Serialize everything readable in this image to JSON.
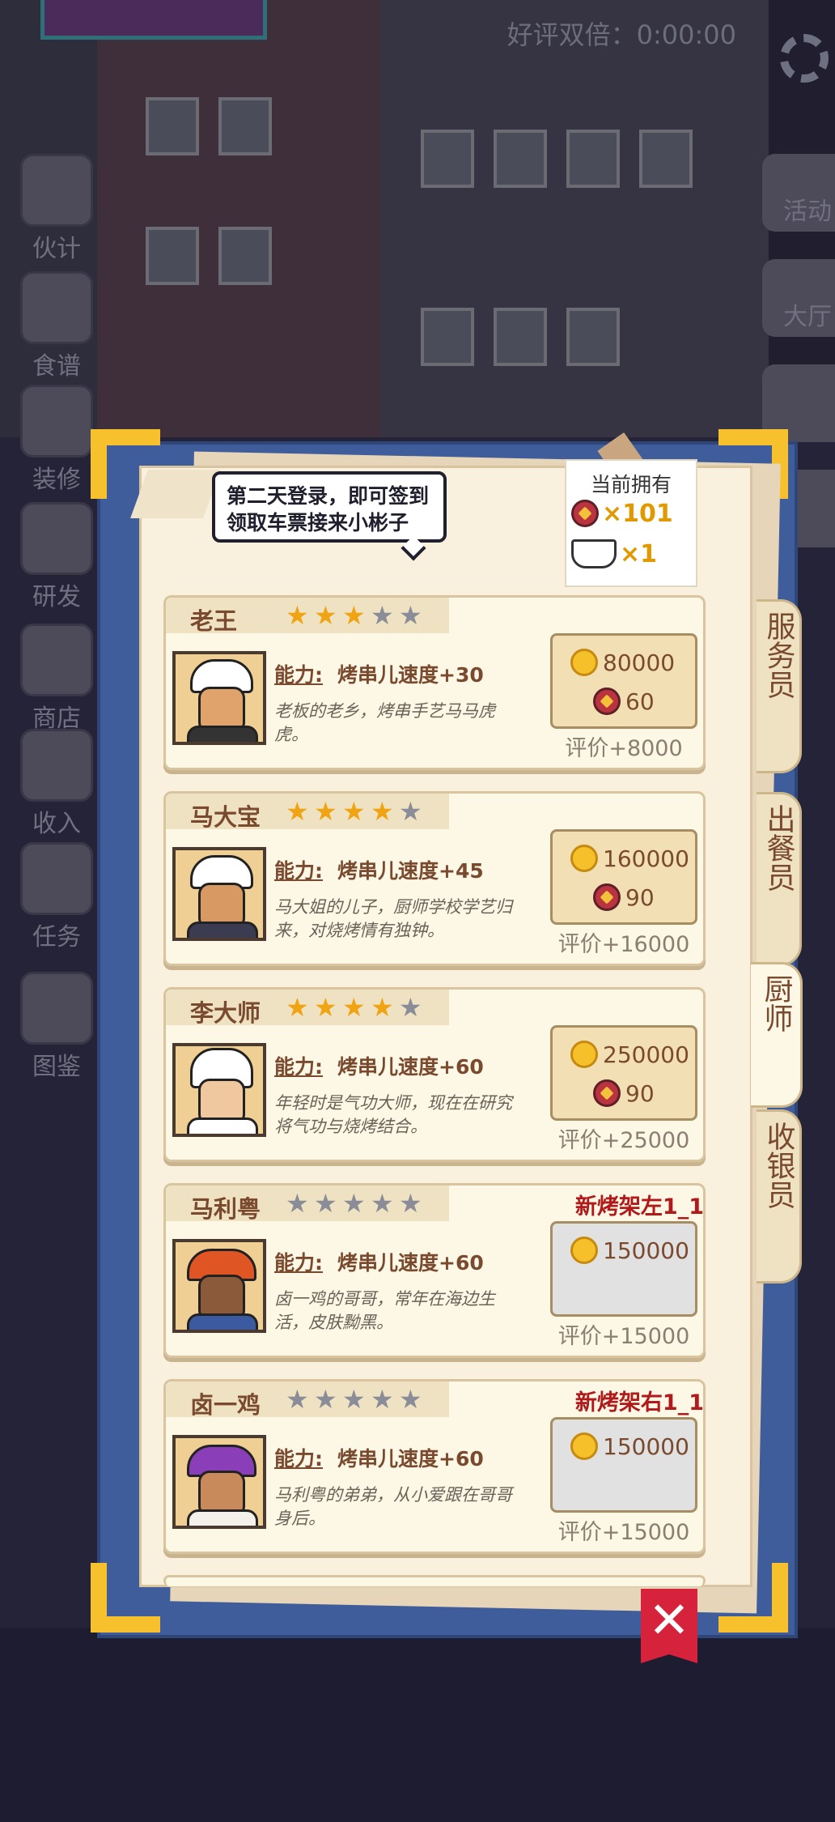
{
  "hud": {
    "top_sign": "",
    "good_review_label": "好评双倍：0:00:00",
    "left_menu": [
      {
        "label": "伙计",
        "icon": "chef-icon"
      },
      {
        "label": "食谱",
        "icon": "skewer-icon"
      },
      {
        "label": "装修",
        "icon": "graduation-cap-icon"
      },
      {
        "label": "研发",
        "icon": "research-icon"
      },
      {
        "label": "商店",
        "icon": "shop-icon"
      },
      {
        "label": "收入",
        "icon": "income-chart-icon"
      },
      {
        "label": "任务",
        "icon": "task-board-icon"
      },
      {
        "label": "图鉴",
        "icon": "catalog-icon"
      }
    ],
    "right_menu": [
      {
        "label": "活动",
        "icon": "calendar-icon"
      },
      {
        "label": "大厅",
        "icon": "hall-icon"
      },
      {
        "label": "",
        "icon": "table-icon"
      },
      {
        "label": "",
        "icon": "ranking-icon"
      }
    ]
  },
  "hint": {
    "line1": "第二天登录，即可签到",
    "line2": "领取车票接来小彬子"
  },
  "owned": {
    "title": "当前拥有",
    "tokens": "×101",
    "tickets": "×1"
  },
  "tabs": [
    {
      "label": "服务员",
      "active": false
    },
    {
      "label": "出餐员",
      "active": false
    },
    {
      "label": "厨师",
      "active": true
    },
    {
      "label": "收银员",
      "active": false
    }
  ],
  "staff": [
    {
      "name": "老王",
      "stars": 3,
      "ability_label": "能力:",
      "ability": "烤串儿速度+30",
      "desc": "老板的老乡，烤串手艺马马虎虎。",
      "coin_cost": "80000",
      "token_cost": "60",
      "review": "评价+8000",
      "unlock": "",
      "locked": false
    },
    {
      "name": "马大宝",
      "stars": 4,
      "ability_label": "能力:",
      "ability": "烤串儿速度+45",
      "desc": "马大姐的儿子，厨师学校学艺归来，对烧烤情有独钟。",
      "coin_cost": "160000",
      "token_cost": "90",
      "review": "评价+16000",
      "unlock": "",
      "locked": false
    },
    {
      "name": "李大师",
      "stars": 4,
      "ability_label": "能力:",
      "ability": "烤串儿速度+60",
      "desc": "年轻时是气功大师，现在在研究将气功与烧烤结合。",
      "coin_cost": "250000",
      "token_cost": "90",
      "review": "评价+25000",
      "unlock": "",
      "locked": false
    },
    {
      "name": "马利粤",
      "stars": 0,
      "ability_label": "能力:",
      "ability": "烤串儿速度+60",
      "desc": "卤一鸡的哥哥，常年在海边生活，皮肤黝黑。",
      "coin_cost": "150000",
      "token_cost": "",
      "review": "评价+15000",
      "unlock": "新烤架左1_1",
      "locked": true
    },
    {
      "name": "卤一鸡",
      "stars": 0,
      "ability_label": "能力:",
      "ability": "烤串儿速度+60",
      "desc": "马利粤的弟弟，从小爱跟在哥哥身后。",
      "coin_cost": "150000",
      "token_cost": "",
      "review": "评价+15000",
      "unlock": "新烤架右1_1",
      "locked": true
    }
  ],
  "close_label": "✕"
}
